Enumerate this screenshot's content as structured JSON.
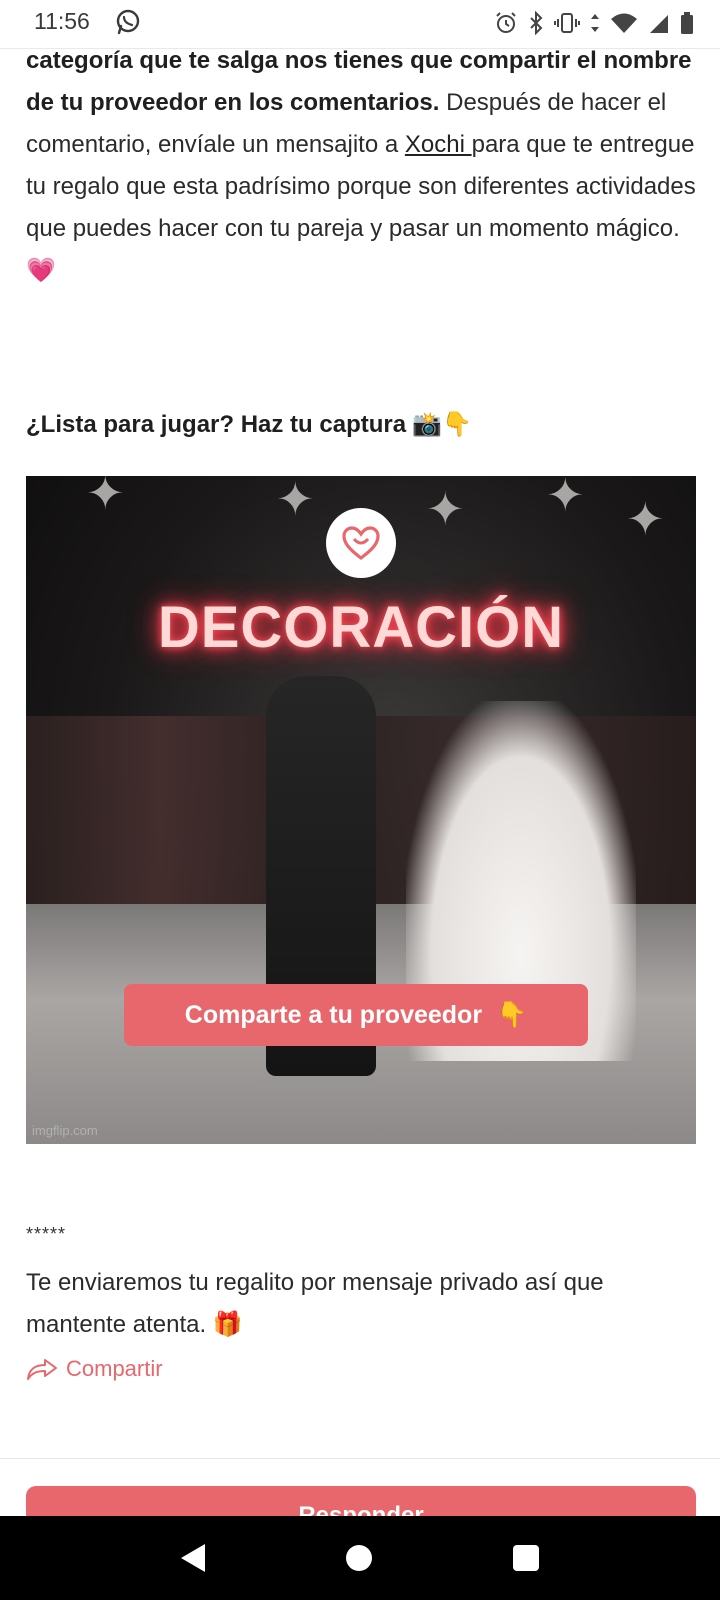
{
  "status_bar": {
    "time": "11:56"
  },
  "article": {
    "para1_bold": "categoría que te salga nos tienes que compartir el nombre de tu proveedor en los comentarios.",
    "para1_text_a": " Después de hacer el comentario, envíale un mensajito a ",
    "para1_link": "Xochi ",
    "para1_text_b": "para que te entregue tu regalo que esta padrísimo porque son diferentes actividades que puedes hacer con tu pareja y pasar un momento mágico. ",
    "para1_emoji": "💗",
    "heading": "¿Lista para jugar? Haz tu captura",
    "heading_emojis": "📸👇",
    "image": {
      "title": "DECORACIÓN",
      "button_label": "Comparte a tu proveedor",
      "button_emoji": "👇",
      "watermark": "imgflip.com"
    },
    "separator": "*****",
    "para2": "Te enviaremos tu regalito por mensaje privado así que mantente atenta. ",
    "para2_emoji": "🎁",
    "share_label": "Compartir"
  },
  "bottom_button_label": "Responder",
  "colors": {
    "accent": "#e8676c",
    "text": "#2b2b2b"
  }
}
